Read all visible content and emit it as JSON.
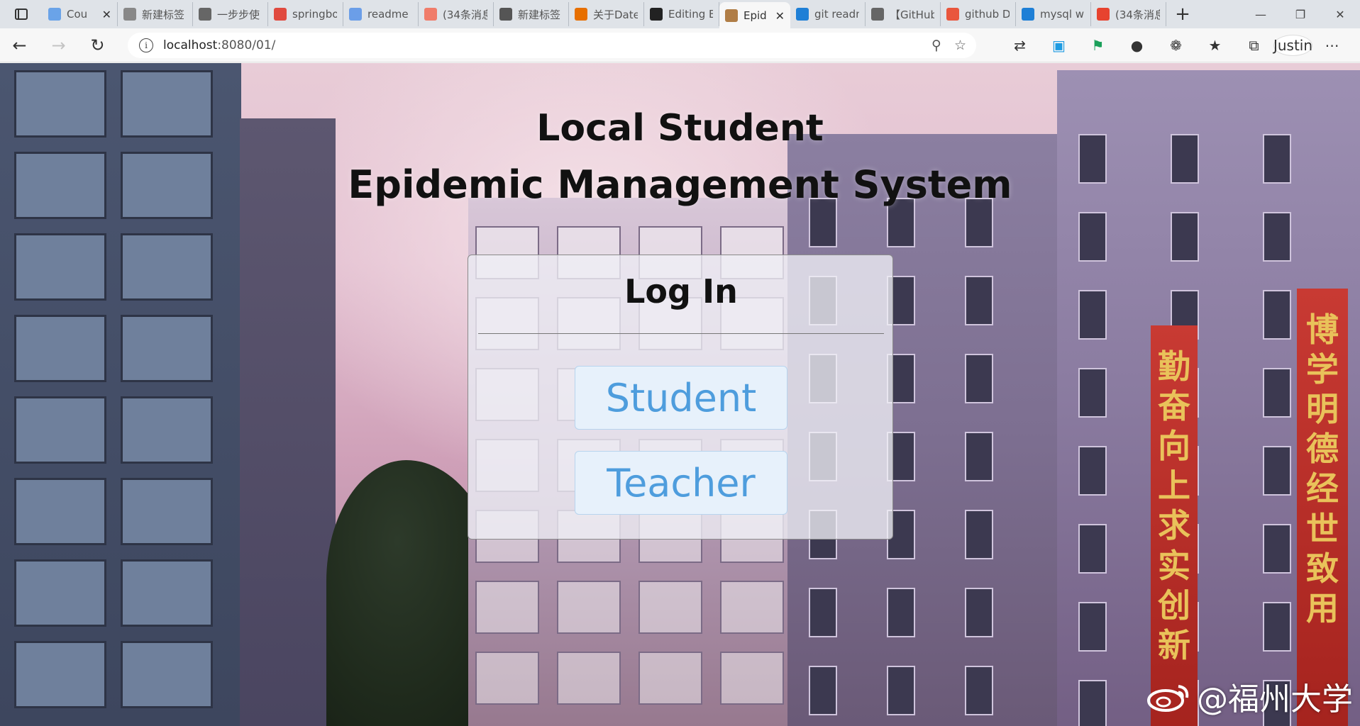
{
  "browser": {
    "tabs": [
      {
        "label": "Cou",
        "icon": "colorful-grid-icon",
        "color": "#6aa3e8",
        "closable": true
      },
      {
        "label": "新建标签",
        "icon": "new-tab-icon",
        "color": "#888888"
      },
      {
        "label": "一步步使",
        "icon": "yuque-icon",
        "color": "#666666"
      },
      {
        "label": "springbo",
        "icon": "google-icon",
        "color": "#e04a3f"
      },
      {
        "label": "readme",
        "icon": "bing-icon",
        "color": "#6b9ee8"
      },
      {
        "label": "(34条消息",
        "icon": "csdn-icon",
        "color": "#f07c6a"
      },
      {
        "label": "新建标签",
        "icon": "new-tab-icon",
        "color": "#555555"
      },
      {
        "label": "关于Date",
        "icon": "java-icon",
        "color": "#e76f00"
      },
      {
        "label": "Editing E",
        "icon": "github-icon",
        "color": "#222222"
      },
      {
        "label": "Epid",
        "icon": "image-favicon-icon",
        "color": "#b07d46",
        "active": true
      },
      {
        "label": "git readn",
        "icon": "bing-icon",
        "color": "#1e7fd6"
      },
      {
        "label": "【GitHub",
        "icon": "yuque-icon",
        "color": "#666666"
      },
      {
        "label": "github D",
        "icon": "jianshu-icon",
        "color": "#e9563d"
      },
      {
        "label": "mysql w",
        "icon": "bing-icon",
        "color": "#1e7fd6"
      },
      {
        "label": "(34条消息",
        "icon": "csdn-icon",
        "color": "#e7432f"
      }
    ],
    "new_tab_glyph": "+",
    "url_host": "localhost",
    "url_rest": ":8080/01/",
    "profile_name": "Justin"
  },
  "page": {
    "title_line1": "Local Student",
    "title_line2": "Epidemic Management System",
    "login": {
      "heading": "Log In",
      "student_label": "Student",
      "teacher_label": "Teacher"
    },
    "banner_left": "勤奋向上求实创新",
    "banner_right": "博学明德经世致用",
    "watermark": "@福州大学"
  },
  "colors": {
    "button_text": "#4e9ddd",
    "button_bg": "#e7f1fb",
    "banner_red": "#c83a33"
  }
}
